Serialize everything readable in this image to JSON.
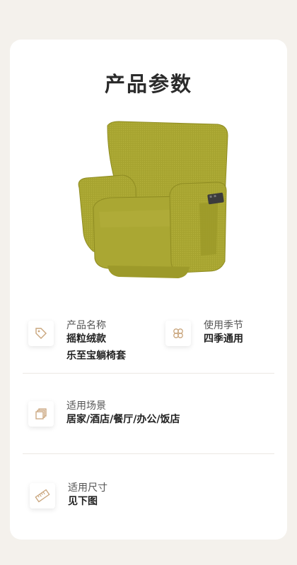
{
  "page": {
    "title": "产品参数"
  },
  "params": {
    "name": {
      "icon": "tag-icon",
      "label": "产品名称",
      "value_line1": "摇粒绒款",
      "value_line2": "乐至宝躺椅套"
    },
    "season": {
      "icon": "clover-icon",
      "label": "使用季节",
      "value": "四季通用"
    },
    "scene": {
      "icon": "stack-icon",
      "label": "适用场景",
      "value": "居家/酒店/餐厅/办公/饭店"
    },
    "size": {
      "icon": "ruler-icon",
      "label": "适用尺寸",
      "value": "见下图"
    }
  },
  "colors": {
    "accent_icon": "#c9a57c",
    "chair_fabric": "#a7a430",
    "background": "#f4f1ec"
  }
}
